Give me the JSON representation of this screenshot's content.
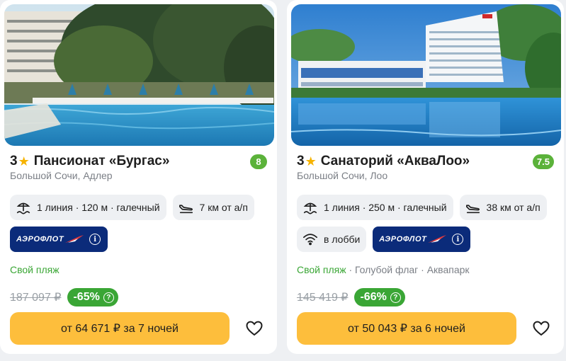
{
  "cards": [
    {
      "stars": "3",
      "star_icon": "star-icon",
      "name": "Пансионат «Бургас»",
      "rating": "8",
      "location": "Большой Сочи, Адлер",
      "beach": "1 линия · 120 м · галечный",
      "airport": "7 км от а/п",
      "airline": "АЭРОФЛОТ",
      "features_main": "Свой пляж",
      "features_more": "",
      "old_price": "187 097 ₽",
      "discount": "-65%",
      "button": "от 64 671 ₽ за 7 ночей"
    },
    {
      "stars": "3",
      "star_icon": "star-icon",
      "name": "Санаторий «АкваЛоо»",
      "rating": "7.5",
      "location": "Большой Сочи, Лоо",
      "beach": "1 линия · 250 м · галечный",
      "airport": "38 км от а/п",
      "wifi": "в лобби",
      "airline": "АЭРОФЛОТ",
      "features_main": "Свой пляж",
      "features_more": " · Голубой флаг · Аквапарк",
      "old_price": "145 419 ₽",
      "discount": "-66%",
      "button": "от 50 043 ₽ за 6 ночей"
    }
  ],
  "colors": {
    "accent_button": "#fdbe3c",
    "rating_green": "#5bb23a",
    "discount_green": "#3aa635",
    "aeroflot_blue": "#0b2b7a",
    "star_yellow": "#f6b300"
  },
  "icons": [
    "beach-umbrella-icon",
    "plane-landing-icon",
    "wifi-icon",
    "info-icon",
    "question-icon",
    "heart-icon"
  ]
}
